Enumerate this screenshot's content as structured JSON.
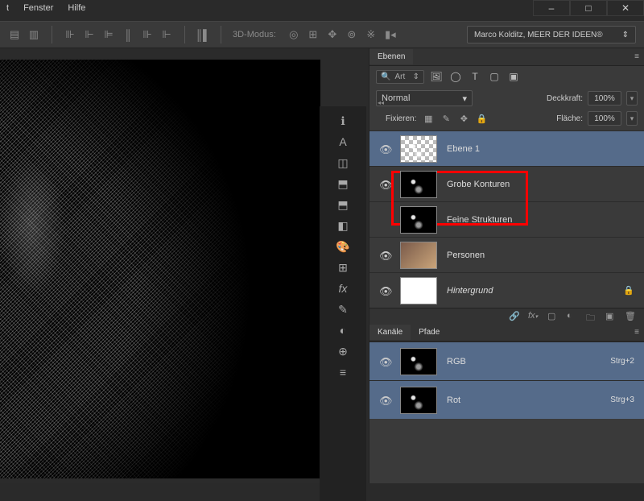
{
  "menu": {
    "item1": "t",
    "fenster": "Fenster",
    "hilfe": "Hilfe"
  },
  "titlebar": {
    "minimize": "–",
    "maximize": "□",
    "close": "✕"
  },
  "optbar": {
    "mode3d_label": "3D-Modus:",
    "workspace": "Marco Kolditz, MEER DER IDEEN®"
  },
  "panels": {
    "layers": {
      "tab": "Ebenen",
      "filter_label": "Art",
      "blend": "Normal",
      "opacity_label": "Deckkraft:",
      "opacity_val": "100%",
      "fill_label": "Fläche:",
      "fill_val": "100%",
      "lock_label": "Fixieren:",
      "items": [
        {
          "name": "Ebene 1",
          "visible": true,
          "selected": true,
          "thumb": "checker"
        },
        {
          "name": "Grobe Konturen",
          "visible": true,
          "thumb": "black"
        },
        {
          "name": "Feine Strukturen",
          "visible": false,
          "thumb": "black"
        },
        {
          "name": "Personen",
          "visible": true,
          "thumb": "photo"
        },
        {
          "name": "Hintergrund",
          "visible": true,
          "thumb": "white",
          "locked": true,
          "italic": true
        }
      ],
      "footer_icons": [
        "link",
        "fx",
        "mask",
        "adjust",
        "group",
        "new",
        "trash"
      ]
    },
    "channels": {
      "tab_kanale": "Kanäle",
      "tab_pfade": "Pfade",
      "items": [
        {
          "name": "RGB",
          "shortcut": "Strg+2"
        },
        {
          "name": "Rot",
          "shortcut": "Strg+3"
        }
      ]
    }
  },
  "glyphs": {
    "search": "🔍",
    "down": "▾",
    "up": "▴",
    "eye": "👁",
    "lock": "🔒",
    "link": "🔗",
    "image": "🖼",
    "circle": "◯",
    "text": "T",
    "square": "▢",
    "more": "•",
    "menu": "≡",
    "checker": "▦",
    "brush": "✎",
    "move": "✥",
    "allLock": "🔒",
    "nub": "◂◂",
    "left": "⟲",
    "right": "⟳",
    "sphere": "◎",
    "plane": "▭",
    "camera": "📷",
    "updown": "↕"
  },
  "stripIcons": [
    "ℹ",
    "A",
    "◫",
    "⬒",
    "⬒",
    "◧",
    "🎨",
    "⊞",
    "fx",
    "✎",
    "◐",
    "⊕",
    "≡"
  ]
}
